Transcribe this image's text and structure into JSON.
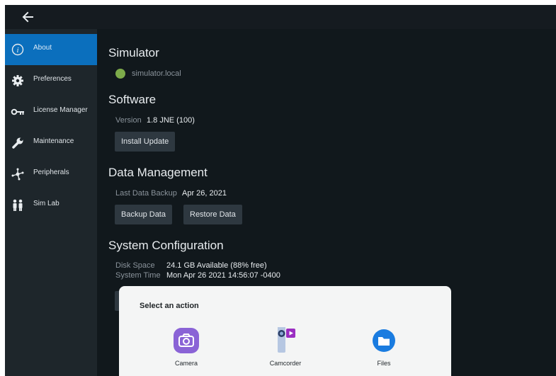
{
  "header": {
    "back_icon": "arrow-left-icon"
  },
  "sidebar": {
    "items": [
      {
        "label": "About",
        "icon": "info-icon",
        "active": true
      },
      {
        "label": "Preferences",
        "icon": "gear-icon",
        "active": false
      },
      {
        "label": "License Manager",
        "icon": "key-icon",
        "active": false
      },
      {
        "label": "Maintenance",
        "icon": "wrench-icon",
        "active": false
      },
      {
        "label": "Peripherals",
        "icon": "network-icon",
        "active": false
      },
      {
        "label": "Sim Lab",
        "icon": "people-icon",
        "active": false
      }
    ]
  },
  "main": {
    "simulator": {
      "heading": "Simulator",
      "host": "simulator.local",
      "status_color": "#7dab4a"
    },
    "software": {
      "heading": "Software",
      "version_label": "Version",
      "version_value": "1.8 JNE (100)",
      "install_button": "Install Update"
    },
    "data_management": {
      "heading": "Data Management",
      "backup_label": "Last Data Backup",
      "backup_value": "Apr 26, 2021",
      "backup_button": "Backup Data",
      "restore_button": "Restore Data"
    },
    "system_configuration": {
      "heading": "System Configuration",
      "disk_label": "Disk Space",
      "disk_value": "24.1 GB Available (88% free)",
      "time_label": "System Time",
      "time_value": "Mon Apr 26 2021 14:56:07 -0400"
    }
  },
  "action_sheet": {
    "title": "Select an action",
    "apps": [
      {
        "label": "Camera",
        "icon": "camera-icon"
      },
      {
        "label": "Camcorder",
        "icon": "camcorder-icon"
      },
      {
        "label": "Files",
        "icon": "folder-icon"
      }
    ]
  },
  "colors": {
    "accent": "#0b6fbd",
    "background": "#11181c",
    "sidebar": "#1e262b",
    "button": "#2e3840"
  }
}
